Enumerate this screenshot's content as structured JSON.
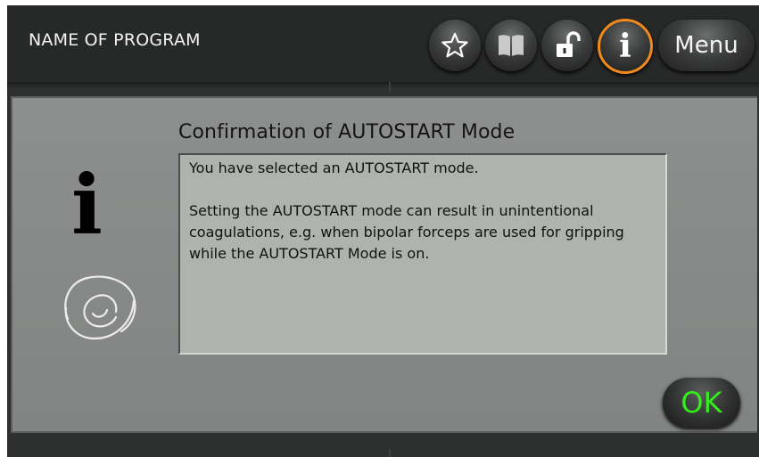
{
  "header": {
    "title": "NAME OF PROGRAM",
    "menu_label": "Menu",
    "icons": [
      "star-icon",
      "book-icon",
      "unlock-icon",
      "info-icon"
    ],
    "accent_color": "#f08a1c"
  },
  "dialog": {
    "title": "Confirmation of AUTOSTART Mode",
    "message_line1": "You have selected an AUTOSTART mode.",
    "message_line2": "Setting the AUTOSTART mode can result in unintentional coagulations, e.g. when bipolar forceps are used for gripping while the AUTOSTART Mode is on.",
    "ok_label": "OK",
    "ok_color": "#33ee1a",
    "info_glyph": "i"
  }
}
